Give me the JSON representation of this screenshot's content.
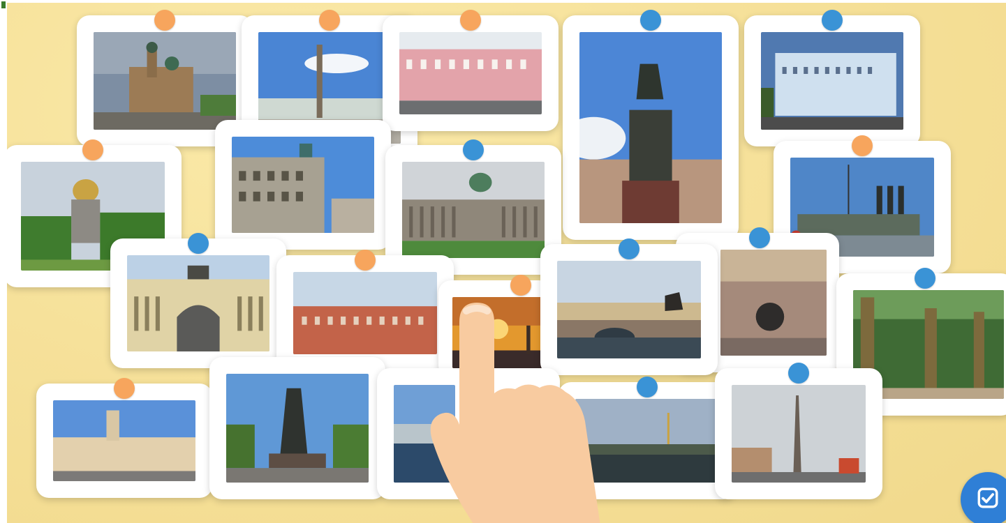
{
  "game": {
    "board_color": "#f6e19a",
    "pin_colors": {
      "orange": "#f7a55d",
      "blue": "#3a93d6"
    },
    "cards": [
      {
        "id": "savior-on-spilled-blood",
        "pin": "orange"
      },
      {
        "id": "alexander-column",
        "pin": "orange"
      },
      {
        "id": "pink-palace",
        "pin": "orange"
      },
      {
        "id": "nicholas-monument",
        "pin": "blue"
      },
      {
        "id": "naval-institute",
        "pin": "blue"
      },
      {
        "id": "isaac-cathedral",
        "pin": "orange"
      },
      {
        "id": "singer-house",
        "pin": "none"
      },
      {
        "id": "kazan-cathedral",
        "pin": "blue"
      },
      {
        "id": "cruiser-aurora",
        "pin": "orange"
      },
      {
        "id": "general-staff-arch",
        "pin": "blue"
      },
      {
        "id": "arsenal-building",
        "pin": "orange"
      },
      {
        "id": "rostral-column-sunset",
        "pin": "orange"
      },
      {
        "id": "anichkov-bridge",
        "pin": "blue"
      },
      {
        "id": "sphere-fountain",
        "pin": "blue"
      },
      {
        "id": "summer-garden-fence",
        "pin": "blue"
      },
      {
        "id": "moscow-station",
        "pin": "orange"
      },
      {
        "id": "catherine-monument",
        "pin": "none"
      },
      {
        "id": "neva-embankment",
        "pin": "none"
      },
      {
        "id": "peter-paul-fortress",
        "pin": "blue"
      },
      {
        "id": "obelisk-square",
        "pin": "blue"
      }
    ]
  },
  "check_button": {
    "icon": "checkbox-check-icon",
    "color": "#2f7fd6"
  },
  "hand": {
    "icon": "pointing-hand-icon",
    "color": "#f8cba0"
  }
}
